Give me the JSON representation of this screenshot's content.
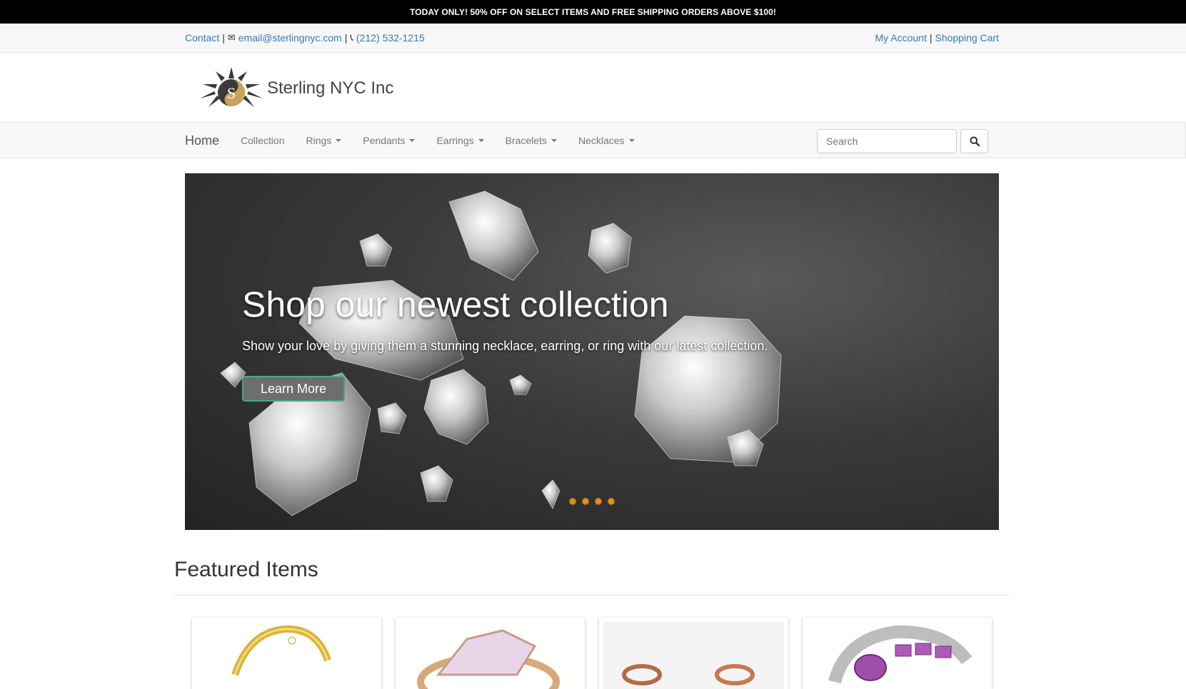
{
  "promo": {
    "text": "TODAY ONLY! 50% OFF ON SELECT ITEMS AND FREE SHIPPING ORDERS ABOVE $100!"
  },
  "topbar": {
    "contact_label": "Contact",
    "separator": "|",
    "email": "email@sterlingnyc.com",
    "phone": "(212) 532-1215",
    "my_account": "My Account",
    "shopping_cart": "Shopping Cart"
  },
  "brand": {
    "name": "Sterling NYC Inc"
  },
  "nav": {
    "home": "Home",
    "items": [
      {
        "label": "Collection",
        "dropdown": false
      },
      {
        "label": "Rings",
        "dropdown": true
      },
      {
        "label": "Pendants",
        "dropdown": true
      },
      {
        "label": "Earrings",
        "dropdown": true
      },
      {
        "label": "Bracelets",
        "dropdown": true
      },
      {
        "label": "Necklaces",
        "dropdown": true
      }
    ],
    "search_placeholder": "Search"
  },
  "hero": {
    "title": "Shop our newest collection",
    "subtitle": "Show your love by giving them a stunning necklace, earring, or ring with our latest collection.",
    "button": "Learn More",
    "slides": 4
  },
  "featured": {
    "title": "Featured Items",
    "cards": [
      "gold-bracelet",
      "pink-gem-ring",
      "copper-ring",
      "purple-gem-ring"
    ]
  },
  "colors": {
    "link": "#337ab7",
    "dot": "#e0901a",
    "promo_bg": "#000000"
  }
}
